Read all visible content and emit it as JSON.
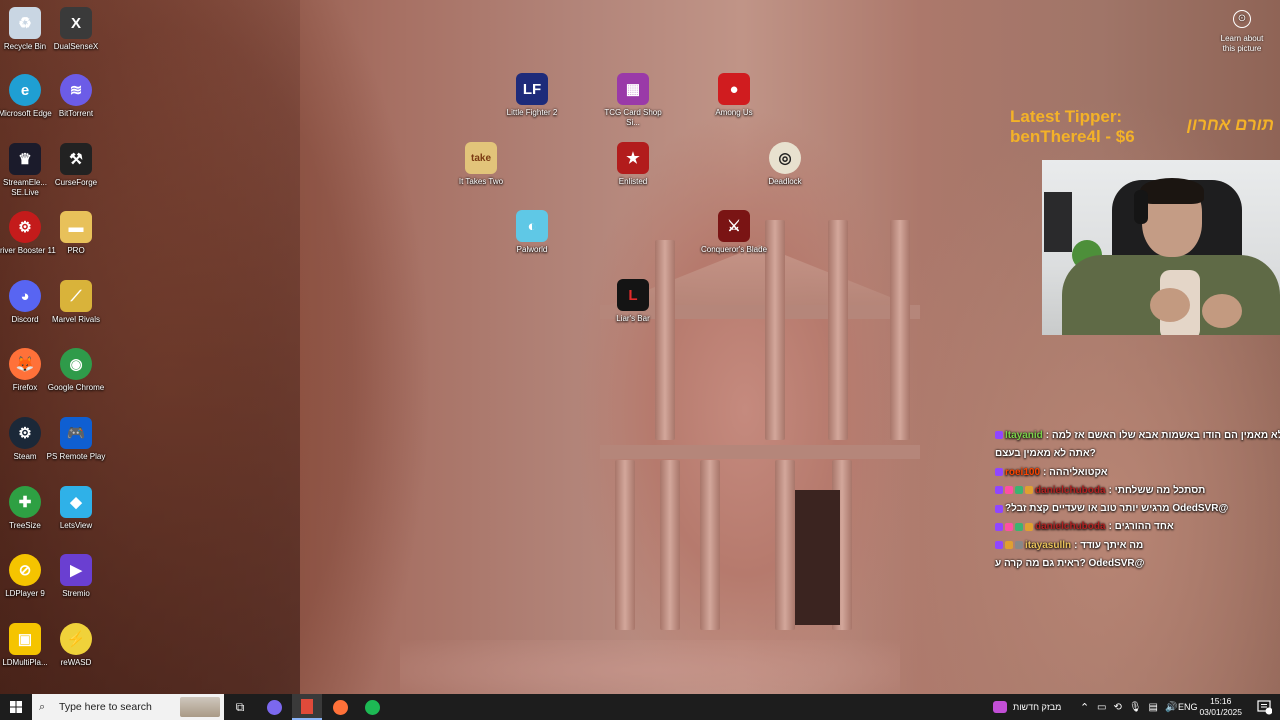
{
  "desktop_icons": [
    {
      "label": "Recycle Bin",
      "icon": "recycle-bin-icon",
      "color": "#c9d6e3"
    },
    {
      "label": "DualSenseX",
      "icon": "dualsensex-icon",
      "color": "#3a3a3a"
    },
    {
      "label": "Microsoft Edge",
      "icon": "edge-icon",
      "color": "#1f9fd3"
    },
    {
      "label": "BitTorrent",
      "icon": "bittorrent-icon",
      "color": "#6c5ce7"
    },
    {
      "label": "StreamEle... SE.Live",
      "icon": "streamelements-icon",
      "color": "#1b1b2b"
    },
    {
      "label": "CurseForge",
      "icon": "curseforge-icon",
      "color": "#222222"
    },
    {
      "label": "Driver Booster 11",
      "icon": "driver-booster-icon",
      "color": "#c41b1b"
    },
    {
      "label": "PRO",
      "icon": "folder-icon",
      "color": "#e8c15a"
    },
    {
      "label": "Discord",
      "icon": "discord-icon",
      "color": "#5865f2"
    },
    {
      "label": "Marvel Rivals",
      "icon": "marvel-rivals-icon",
      "color": "#d9b33a"
    },
    {
      "label": "Firefox",
      "icon": "firefox-icon",
      "color": "#ff7139"
    },
    {
      "label": "Google Chrome",
      "icon": "chrome-icon",
      "color": "#2f9b4a"
    },
    {
      "label": "Steam",
      "icon": "steam-icon",
      "color": "#1b2838"
    },
    {
      "label": "PS Remote Play",
      "icon": "ps-remote-play-icon",
      "color": "#0f5fd2"
    },
    {
      "label": "TreeSize",
      "icon": "treesize-icon",
      "color": "#2ea043"
    },
    {
      "label": "LetsView",
      "icon": "letsview-icon",
      "color": "#2fb1e8"
    },
    {
      "label": "LDPlayer 9",
      "icon": "ldplayer-icon",
      "color": "#f5c400"
    },
    {
      "label": "Stremio",
      "icon": "stremio-icon",
      "color": "#6a3fd1"
    },
    {
      "label": "LDMultiPla...",
      "icon": "ldmultiplayer-icon",
      "color": "#f5c400"
    },
    {
      "label": "reWASD",
      "icon": "rewasd-icon",
      "color": "#f0d23a"
    },
    {
      "label": "Little Fighter 2",
      "icon": "little-fighter-icon",
      "color": "#1e2b7a"
    },
    {
      "label": "TCG Card Shop Si...",
      "icon": "tcg-card-shop-icon",
      "color": "#9a3aa8"
    },
    {
      "label": "Among Us",
      "icon": "among-us-icon",
      "color": "#d01c1f"
    },
    {
      "label": "It Takes Two",
      "icon": "it-takes-two-icon",
      "color": "#e2c47a"
    },
    {
      "label": "Enlisted",
      "icon": "enlisted-icon",
      "color": "#b21c1c"
    },
    {
      "label": "Deadlock",
      "icon": "deadlock-icon",
      "color": "#e8e1cf"
    },
    {
      "label": "Palworld",
      "icon": "palworld-icon",
      "color": "#5fc8e6"
    },
    {
      "label": "Conqueror's Blade",
      "icon": "conquerors-blade-icon",
      "color": "#7a1414"
    },
    {
      "label": "Liar's Bar",
      "icon": "liars-bar-icon",
      "color": "#141414"
    }
  ],
  "learn_picture": {
    "label": "Learn about this picture",
    "icon": "camera-icon"
  },
  "tipper": {
    "line1": "Latest Tipper:",
    "line2": "benThere4l - $6",
    "hebrew": "תורם אחרון",
    "color": "#f4b228"
  },
  "chat": [
    {
      "user": "Itayanid",
      "user_color": "#7cd14b",
      "text": "לא מאמין הם הודו באשמות אבא שלו האשם אז למה",
      "badges": [
        "#9146ff"
      ]
    },
    {
      "user": "",
      "user_color": "#ffffff",
      "text": "?אתה לא מאמין בעצם",
      "badges": []
    },
    {
      "user": "roei100",
      "user_color": "#ff4500",
      "text": "אקטואליההה",
      "badges": [
        "#9146ff"
      ]
    },
    {
      "user": "danielchuboda",
      "user_color": "#b22222",
      "text": "תסתכל מה ששלחתי",
      "badges": [
        "#9146ff",
        "#ff4fa3",
        "#3cb371",
        "#e0a030"
      ]
    },
    {
      "user": "",
      "user_color": "#1e3fbf",
      "text": "@OdedSVR מרגיש יותר טוב או שעדיים קצת זבל?",
      "badges": [
        "#9146ff"
      ]
    },
    {
      "user": "danielchuboda",
      "user_color": "#b22222",
      "text": "אחד ההורגים",
      "badges": [
        "#9146ff",
        "#ff4fa3",
        "#3cb371",
        "#e0a030"
      ]
    },
    {
      "user": "itayasulln",
      "user_color": "#e8c15a",
      "text": "מה איתך עודד",
      "badges": [
        "#9146ff",
        "#e0a030",
        "#888888"
      ]
    },
    {
      "user": "",
      "user_color": "#ffffff",
      "text": "@OdedSVR ?ראית גם מה קרה ע",
      "badges": []
    }
  ],
  "taskbar": {
    "search_placeholder": "Type here to search",
    "apps": [
      {
        "icon": "task-view-icon",
        "color": "#ffffff"
      },
      {
        "icon": "streamlabs-icon",
        "color": "#7b68ee"
      },
      {
        "icon": "obs-icon",
        "color": "#e04a3a"
      },
      {
        "icon": "firefox-icon",
        "color": "#ff7139"
      },
      {
        "icon": "spotify-icon",
        "color": "#1db954"
      }
    ],
    "news_label": "מבזק חדשות",
    "language": "ENG",
    "time": "15:16",
    "date": "03/01/2025"
  }
}
